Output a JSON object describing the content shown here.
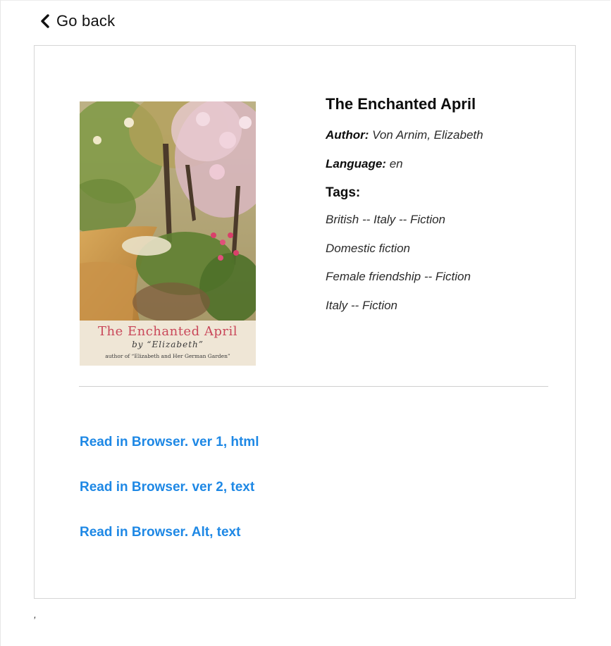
{
  "nav": {
    "back_label": "Go back",
    "back_icon": "chevron-left-icon"
  },
  "book": {
    "title": "The Enchanted April",
    "author_label": "Author:",
    "author": "Von Arnim, Elizabeth",
    "language_label": "Language:",
    "language": "en",
    "tags_heading": "Tags:",
    "tags": [
      "British -- Italy -- Fiction",
      "Domestic fiction",
      "Female friendship -- Fiction",
      "Italy -- Fiction"
    ]
  },
  "cover": {
    "title": "The Enchanted April",
    "by_line": "by “Elizabeth”",
    "subtitle": "author of “Elizabeth and Her German Garden”"
  },
  "links": [
    "Read in Browser. ver 1, html",
    "Read in Browser. ver 2, text",
    "Read in Browser. Alt, text"
  ],
  "footer": {
    "stray_mark": ","
  },
  "colors": {
    "link": "#1e88e5",
    "cover_title": "#c9485a",
    "border": "#d6d6d6"
  }
}
